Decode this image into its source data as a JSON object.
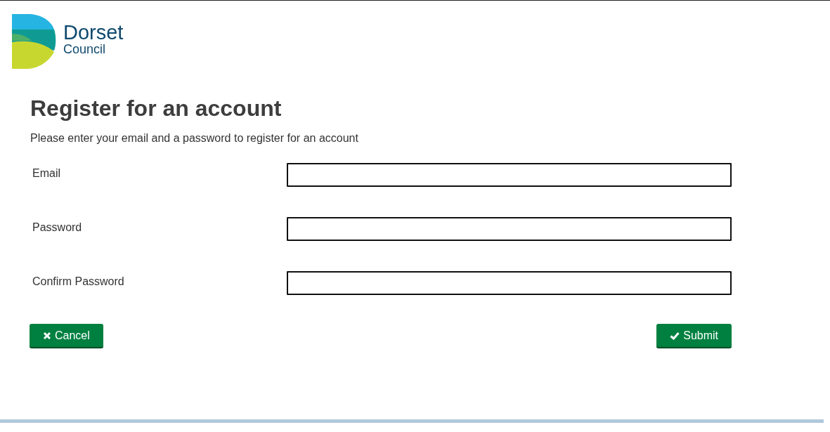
{
  "logo": {
    "name": "Dorset",
    "subname": "Council"
  },
  "heading": "Register for an account",
  "intro": "Please enter your email and a password to register for an account",
  "fields": [
    {
      "label": "Email"
    },
    {
      "label": "Password"
    },
    {
      "label": "Confirm Password"
    }
  ],
  "buttons": {
    "cancel": "Cancel",
    "submit": "Submit"
  }
}
